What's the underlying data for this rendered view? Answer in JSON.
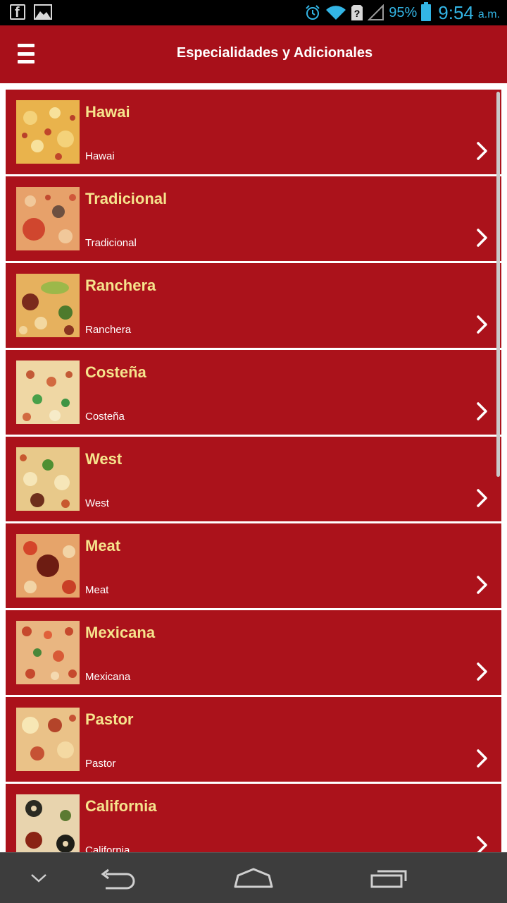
{
  "status_bar": {
    "battery": "95%",
    "time": "9:54",
    "ampm": "a.m.",
    "color": "#33b5e5"
  },
  "app_bar": {
    "title": "Especialidades y Adicionales",
    "menu_icon": "hamburger-menu-icon",
    "color": "#a8101a"
  },
  "items": [
    {
      "title": "Hawai",
      "subtitle": "Hawai"
    },
    {
      "title": "Tradicional",
      "subtitle": "Tradicional"
    },
    {
      "title": "Ranchera",
      "subtitle": "Ranchera"
    },
    {
      "title": "Costeña",
      "subtitle": "Costeña"
    },
    {
      "title": "West",
      "subtitle": "West"
    },
    {
      "title": "Meat",
      "subtitle": "Meat"
    },
    {
      "title": "Mexicana",
      "subtitle": "Mexicana"
    },
    {
      "title": "Pastor",
      "subtitle": "Pastor"
    },
    {
      "title": "California",
      "subtitle": "California"
    }
  ],
  "colors": {
    "row_background": "#ab121b",
    "title_text": "#f6e38c",
    "subtitle_text": "#ffffff"
  },
  "nav_bar": {
    "icons": [
      "chevron-down-icon",
      "back-icon",
      "home-icon",
      "recent-apps-icon"
    ]
  }
}
